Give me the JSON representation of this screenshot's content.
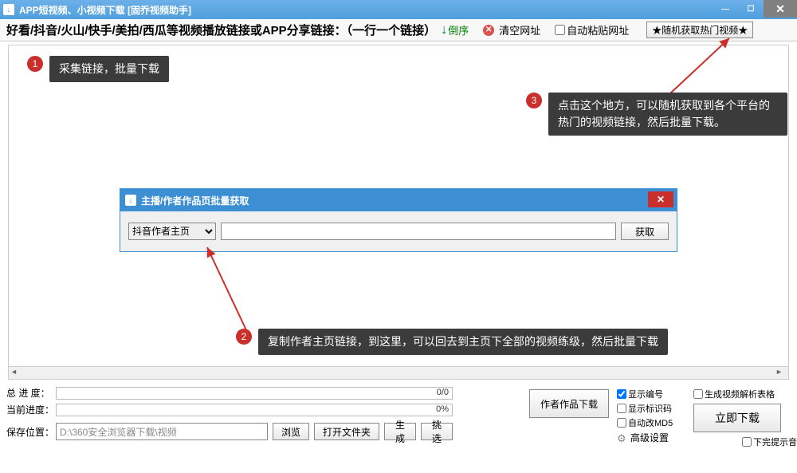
{
  "titlebar": {
    "title": "APP短视频、小视频下载 [固乔视频助手]"
  },
  "toolbar": {
    "main_label": "好看/抖音/火山/快手/美拍/西瓜等视频播放链接或APP分享链接：（一行一个链接）",
    "sort_label": "倒序",
    "clear_label": "清空网址",
    "auto_paste_label": "自动粘贴网址",
    "hot_button": "★随机获取热门视频★"
  },
  "callouts": {
    "c1": "采集链接，批量下载",
    "c2": "复制作者主页链接，到这里，可以回去到主页下全部的视频练级，然后批量下载",
    "c3": "点击这个地方，可以随机获取到各个平台的热门的视频链接，然后批量下载。"
  },
  "dialog": {
    "title": "主播/作者作品页批量获取",
    "select_value": "抖音作者主页",
    "input_value": "",
    "fetch_btn": "获取"
  },
  "bottom": {
    "total_label": "总 进 度：",
    "total_text": "0/0",
    "current_label": "当前进度：",
    "current_text": "0%",
    "save_label": "保存位置：",
    "save_path": "D:\\360安全浏览器下载\\视频",
    "browse_btn": "浏览",
    "open_folder_btn": "打开文件夹",
    "author_btn": "作者作品下载",
    "gen_btn": "生成",
    "pick_btn": "挑选",
    "show_no": "显示编号",
    "show_code": "显示标识码",
    "auto_md5": "自动改MD5",
    "advanced": "高级设置",
    "gen_table": "生成视频解析表格",
    "download_btn": "立即下载",
    "done_sound": "下完提示音"
  }
}
